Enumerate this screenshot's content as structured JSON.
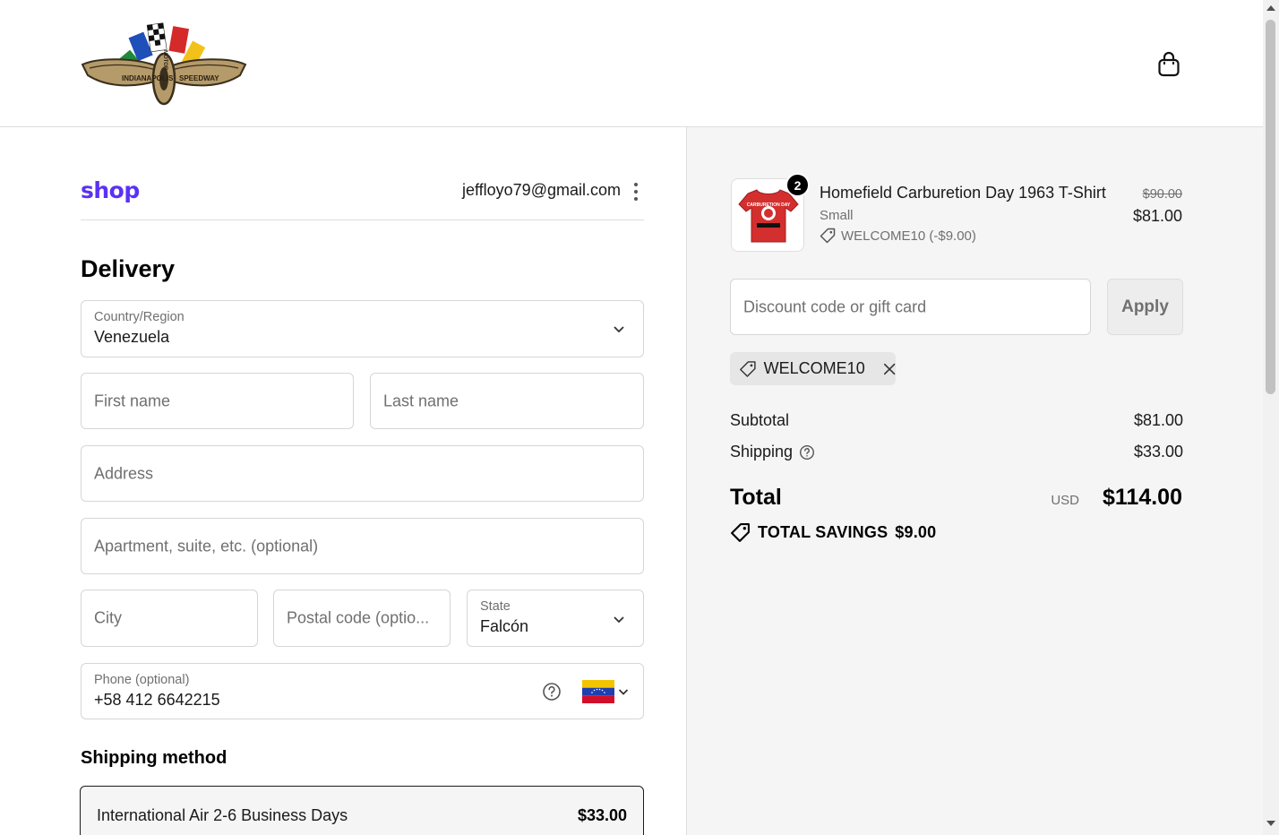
{
  "header": {
    "logo_text_left": "INDIANAPOLIS",
    "logo_text_right": "SPEEDWAY",
    "logo_text_center": "MOTOR",
    "cart_icon": "shopping-bag-icon"
  },
  "account": {
    "shop_logo": "shop",
    "email": "jeffloyo79@gmail.com"
  },
  "delivery": {
    "title": "Delivery",
    "country_label": "Country/Region",
    "country_value": "Venezuela",
    "first_name_placeholder": "First name",
    "last_name_placeholder": "Last name",
    "address_placeholder": "Address",
    "apartment_placeholder": "Apartment, suite, etc. (optional)",
    "city_placeholder": "City",
    "postal_placeholder": "Postal code (optio...",
    "state_label": "State",
    "state_value": "Falcón",
    "phone_label": "Phone (optional)",
    "phone_value": "+58 412 6642215"
  },
  "shipping": {
    "title": "Shipping method",
    "option_name": "International Air 2-6 Business Days",
    "option_price": "$33.00"
  },
  "order": {
    "quantity": "2",
    "product_title": "Homefield Carburetion Day 1963 T-Shirt",
    "variant": "Small",
    "discount_line": "WELCOME10 (-$9.00)",
    "original_price": "$90.00",
    "price": "$81.00",
    "product_image_text": "CARBURETION DAY"
  },
  "discount": {
    "placeholder": "Discount code or gift card",
    "apply_label": "Apply",
    "applied_code": "WELCOME10"
  },
  "summary": {
    "subtotal_label": "Subtotal",
    "subtotal_value": "$81.00",
    "shipping_label": "Shipping",
    "shipping_value": "$33.00",
    "total_label": "Total",
    "currency": "USD",
    "total_value": "$114.00",
    "savings_label": "TOTAL SAVINGS",
    "savings_value": "$9.00"
  },
  "colors": {
    "shop_brand": "#5a31f4",
    "panel_bg": "#f5f5f5",
    "border": "#d6d6d6"
  }
}
